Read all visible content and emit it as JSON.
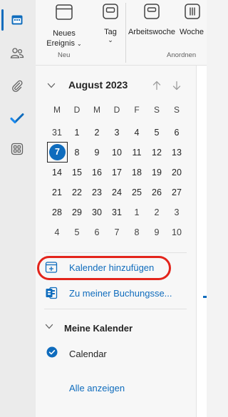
{
  "ribbon": {
    "new_event_line1": "Neues",
    "new_event_line2": "Ereignis",
    "new_group": "Neu",
    "day": "Tag",
    "work_week": "Arbeitswoche",
    "week": "Woche",
    "arrange_group": "Anordnen"
  },
  "calendar": {
    "month_title": "August 2023",
    "weekdays": [
      "M",
      "D",
      "M",
      "D",
      "F",
      "S",
      "S"
    ],
    "weeks": [
      [
        "31",
        "1",
        "2",
        "3",
        "4",
        "5",
        "6"
      ],
      [
        "7",
        "8",
        "9",
        "10",
        "11",
        "12",
        "13"
      ],
      [
        "14",
        "15",
        "16",
        "17",
        "18",
        "19",
        "20"
      ],
      [
        "21",
        "22",
        "23",
        "24",
        "25",
        "26",
        "27"
      ],
      [
        "28",
        "29",
        "30",
        "31",
        "1",
        "2",
        "3"
      ],
      [
        "4",
        "5",
        "6",
        "7",
        "8",
        "9",
        "10"
      ]
    ],
    "today": "7"
  },
  "actions": {
    "add_calendar": "Kalender hinzufügen",
    "booking_page": "Zu meiner Buchungsse..."
  },
  "my_calendars": {
    "title": "Meine Kalender",
    "items": [
      {
        "name": "Calendar",
        "checked": true
      }
    ],
    "show_all": "Alle anzeigen"
  },
  "colors": {
    "accent": "#0f6cbd",
    "highlight_ring": "#e3241b"
  },
  "icons": [
    "calendar-icon",
    "people-icon",
    "paperclip-icon",
    "todo-check-icon",
    "apps-grid-icon"
  ]
}
